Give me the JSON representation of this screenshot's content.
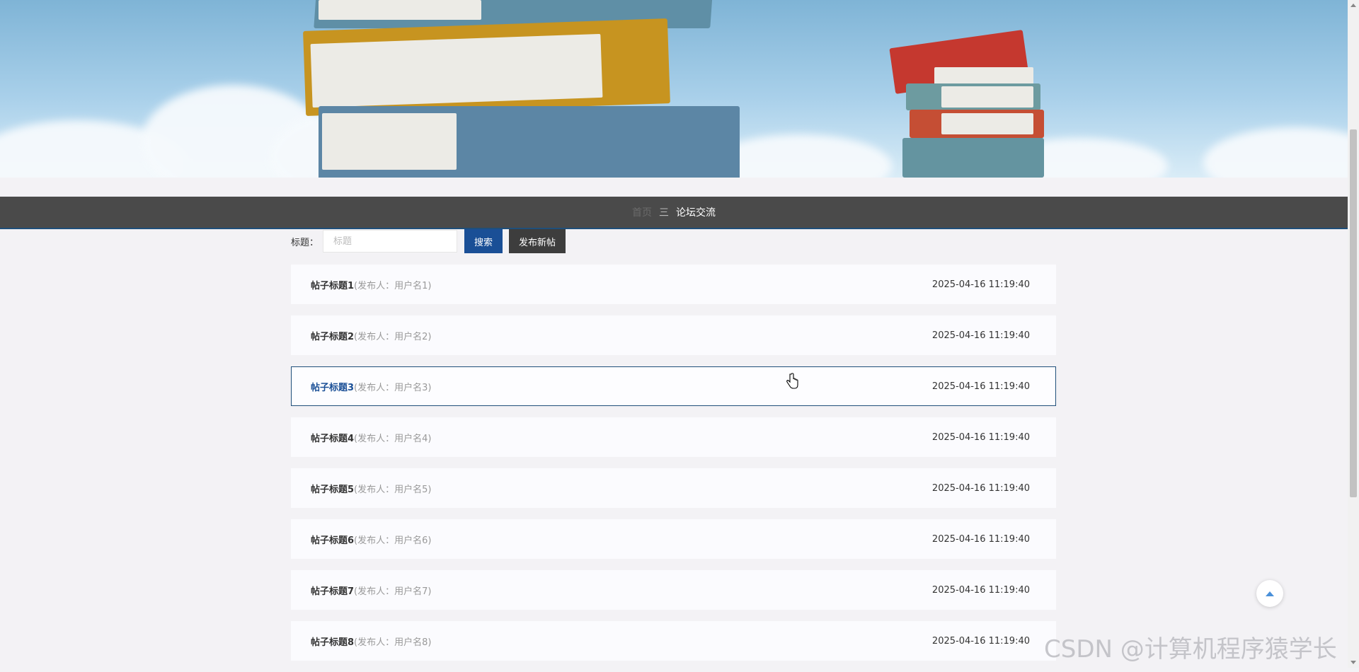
{
  "breadcrumb": {
    "home": "首页",
    "separator": "三",
    "current": "论坛交流"
  },
  "search": {
    "label": "标题：",
    "placeholder": "标题",
    "value": "",
    "search_button": "搜索",
    "new_post_button": "发布新帖"
  },
  "posts": [
    {
      "title": "帖子标题1",
      "author": "(发布人：用户名1)",
      "time": "2025-04-16 11:19:40"
    },
    {
      "title": "帖子标题2",
      "author": "(发布人：用户名2)",
      "time": "2025-04-16 11:19:40"
    },
    {
      "title": "帖子标题3",
      "author": "(发布人：用户名3)",
      "time": "2025-04-16 11:19:40"
    },
    {
      "title": "帖子标题4",
      "author": "(发布人：用户名4)",
      "time": "2025-04-16 11:19:40"
    },
    {
      "title": "帖子标题5",
      "author": "(发布人：用户名5)",
      "time": "2025-04-16 11:19:40"
    },
    {
      "title": "帖子标题6",
      "author": "(发布人：用户名6)",
      "time": "2025-04-16 11:19:40"
    },
    {
      "title": "帖子标题7",
      "author": "(发布人：用户名7)",
      "time": "2025-04-16 11:19:40"
    },
    {
      "title": "帖子标题8",
      "author": "(发布人：用户名8)",
      "time": "2025-04-16 11:19:40"
    }
  ],
  "watermark": "CSDN @计算机程序猿学长",
  "colors": {
    "navbar": "#4a4a4a",
    "search_button": "#1a4f96",
    "new_post_button": "#3d3d3d",
    "accent": "#1f4f7a"
  },
  "icons": [
    "back-to-top-icon",
    "hand-cursor-icon",
    "scroll-up-arrow-icon",
    "scroll-down-arrow-icon"
  ]
}
